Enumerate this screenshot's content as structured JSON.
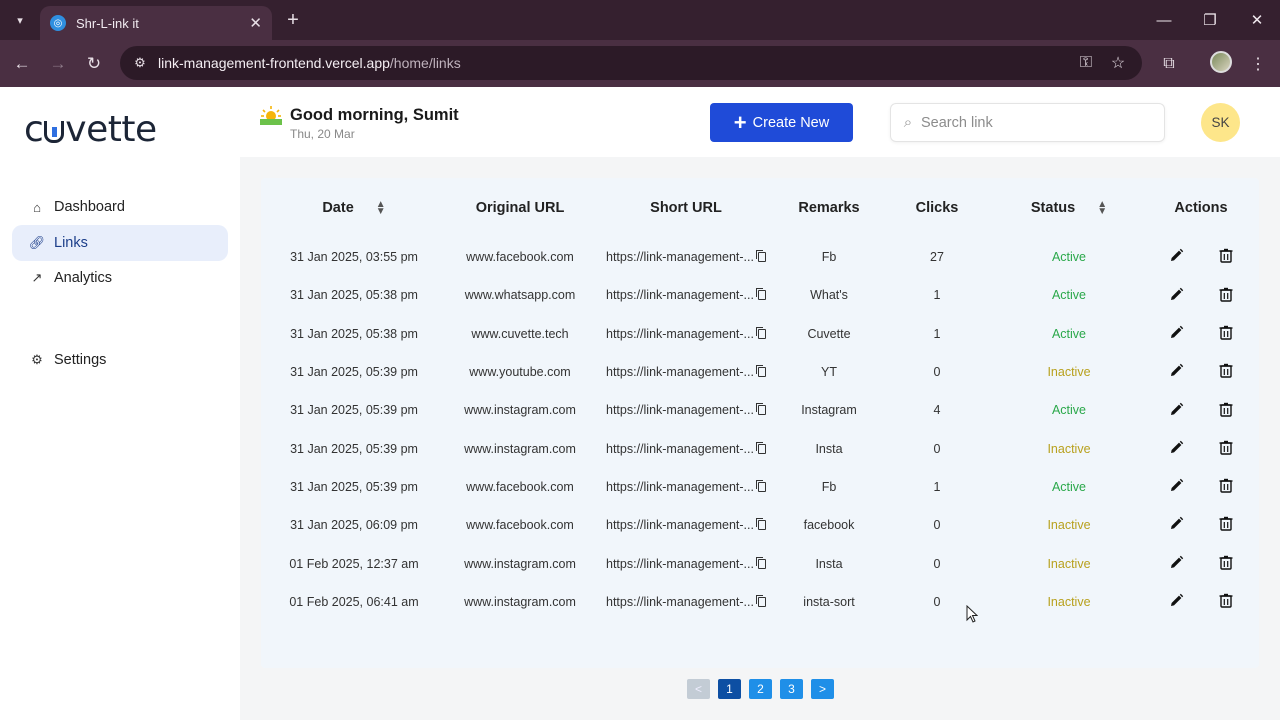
{
  "browser": {
    "tab_title": "Shr-L-ink it",
    "url_host": "link-management-frontend.vercel.app",
    "url_path": "/home/links"
  },
  "sidebar": {
    "logo": "cuvette",
    "items": [
      {
        "label": "Dashboard",
        "icon": "home-icon"
      },
      {
        "label": "Links",
        "icon": "link-icon"
      },
      {
        "label": "Analytics",
        "icon": "trend-icon"
      },
      {
        "label": "Settings",
        "icon": "gear-icon"
      }
    ]
  },
  "header": {
    "greeting": "Good morning, Sumit",
    "date": "Thu, 20 Mar",
    "create_label": "Create New",
    "search_placeholder": "Search link",
    "avatar_initials": "SK"
  },
  "table": {
    "columns": [
      "Date",
      "Original URL",
      "Short URL",
      "Remarks",
      "Clicks",
      "Status",
      "Actions"
    ],
    "rows": [
      {
        "date": "31 Jan 2025, 03:55 pm",
        "original": "www.facebook.com",
        "short": "https://link-management-...",
        "remarks": "Fb",
        "clicks": "27",
        "status": "Active"
      },
      {
        "date": "31 Jan 2025, 05:38 pm",
        "original": "www.whatsapp.com",
        "short": "https://link-management-...",
        "remarks": "What's",
        "clicks": "1",
        "status": "Active"
      },
      {
        "date": "31 Jan 2025, 05:38 pm",
        "original": "www.cuvette.tech",
        "short": "https://link-management-...",
        "remarks": "Cuvette",
        "clicks": "1",
        "status": "Active"
      },
      {
        "date": "31 Jan 2025, 05:39 pm",
        "original": "www.youtube.com",
        "short": "https://link-management-...",
        "remarks": "YT",
        "clicks": "0",
        "status": "Inactive"
      },
      {
        "date": "31 Jan 2025, 05:39 pm",
        "original": "www.instagram.com",
        "short": "https://link-management-...",
        "remarks": "Instagram",
        "clicks": "4",
        "status": "Active"
      },
      {
        "date": "31 Jan 2025, 05:39 pm",
        "original": "www.instagram.com",
        "short": "https://link-management-...",
        "remarks": "Insta",
        "clicks": "0",
        "status": "Inactive"
      },
      {
        "date": "31 Jan 2025, 05:39 pm",
        "original": "www.facebook.com",
        "short": "https://link-management-...",
        "remarks": "Fb",
        "clicks": "1",
        "status": "Active"
      },
      {
        "date": "31 Jan 2025, 06:09 pm",
        "original": "www.facebook.com",
        "short": "https://link-management-...",
        "remarks": "facebook",
        "clicks": "0",
        "status": "Inactive"
      },
      {
        "date": "01 Feb 2025, 12:37 am",
        "original": "www.instagram.com",
        "short": "https://link-management-...",
        "remarks": "Insta",
        "clicks": "0",
        "status": "Inactive"
      },
      {
        "date": "01 Feb 2025, 06:41 am",
        "original": "www.instagram.com",
        "short": "https://link-management-...",
        "remarks": "insta-sort",
        "clicks": "0",
        "status": "Inactive"
      }
    ]
  },
  "pagination": {
    "prev": "<",
    "pages": [
      "1",
      "2",
      "3"
    ],
    "next": ">",
    "current": "1"
  },
  "colors": {
    "accent": "#1f4bd8",
    "active": "#2aa84a",
    "inactive": "#b8a11e"
  }
}
